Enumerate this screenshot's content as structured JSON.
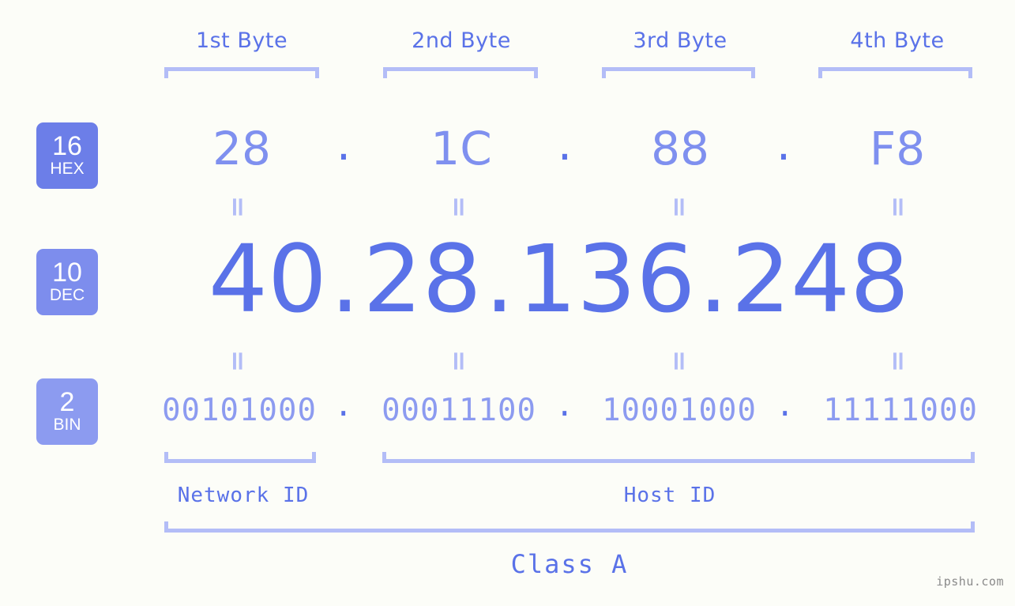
{
  "canvas": {
    "background_color": "#fcfdf8",
    "accent_color": "#5a72e8",
    "light_accent_color": "#b3bdf7"
  },
  "header": {
    "byte_labels": [
      {
        "label": "1st Byte"
      },
      {
        "label": "2nd Byte"
      },
      {
        "label": "3rd Byte"
      },
      {
        "label": "4th Byte"
      }
    ]
  },
  "badges": [
    {
      "base": "16",
      "name": "HEX",
      "color": "#6c7ee8"
    },
    {
      "base": "10",
      "name": "DEC",
      "color": "#7d8ded"
    },
    {
      "base": "2",
      "name": "BIN",
      "color": "#8c9bf0"
    }
  ],
  "rows": {
    "hex": {
      "octets": [
        "28",
        "1C",
        "88",
        "F8"
      ],
      "separator": "."
    },
    "dec": {
      "octets": [
        "40",
        "28",
        "136",
        "248"
      ],
      "separator": "."
    },
    "bin": {
      "octets": [
        "00101000",
        "00011100",
        "10001000",
        "11111000"
      ],
      "separator": "."
    }
  },
  "equals_separator": "=",
  "segments": {
    "network_id": "Network ID",
    "host_id": "Host ID",
    "class": "Class A"
  },
  "watermark": "ipshu.com"
}
